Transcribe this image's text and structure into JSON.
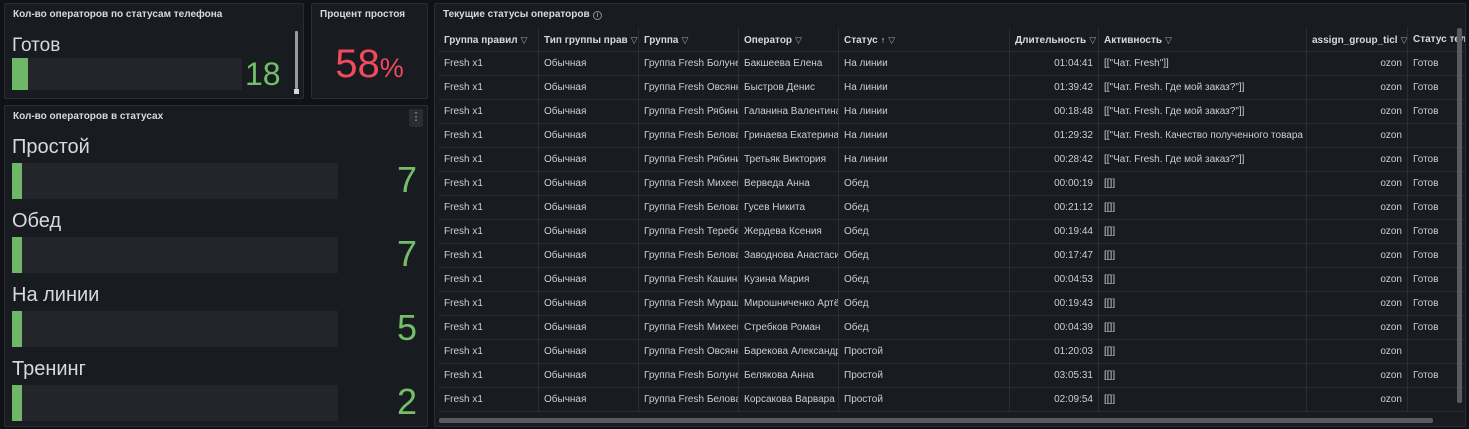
{
  "colors": {
    "green": "#73bf69",
    "red": "#f2495c",
    "panel_bg": "#181b1f",
    "page_bg": "#111217"
  },
  "phone_status_panel": {
    "title": "Кол-во операторов по статусам телефона",
    "items": [
      {
        "label": "Готов",
        "value": "18",
        "fill_fraction": 0.07
      }
    ]
  },
  "idle_panel": {
    "title": "Процент простоя",
    "value": "58",
    "unit": "%"
  },
  "status_count_panel": {
    "title": "Кол-во операторов в статусах",
    "menu_icon": "more-vertical-icon",
    "items": [
      {
        "label": "Простой",
        "value": "7",
        "fill_fraction": 0.03
      },
      {
        "label": "Обед",
        "value": "7",
        "fill_fraction": 0.03
      },
      {
        "label": "На линии",
        "value": "5",
        "fill_fraction": 0.02
      },
      {
        "label": "Тренинг",
        "value": "2",
        "fill_fraction": 0.01
      }
    ]
  },
  "table_panel": {
    "title": "Текущие статусы операторов",
    "info_icon": "info-icon",
    "columns": [
      {
        "label": "Группа правил",
        "filter": true
      },
      {
        "label": "Тип группы прав",
        "filter": true
      },
      {
        "label": "Группа",
        "filter": true
      },
      {
        "label": "Оператор",
        "filter": true
      },
      {
        "label": "Статус",
        "filter": true,
        "sort": "asc"
      },
      {
        "label": "Длительность",
        "filter": true
      },
      {
        "label": "Активность",
        "filter": true
      },
      {
        "label": "assign_group_ticl",
        "filter": true
      },
      {
        "label": "Статус теле",
        "filter": false
      }
    ],
    "rows": [
      [
        "Fresh x1",
        "Обычная",
        "Группа Fresh Болуне",
        "Бакшеева Елена",
        "На линии",
        "01:04:41",
        "[[\"Чат. Fresh\"]]",
        "ozon",
        "Готов"
      ],
      [
        "Fresh x1",
        "Обычная",
        "Группа Fresh Овсянн",
        "Быстров Денис",
        "На линии",
        "01:39:42",
        "[[\"Чат. Fresh. Где мой заказ?\"]]",
        "ozon",
        "Готов"
      ],
      [
        "Fresh x1",
        "Обычная",
        "Группа Fresh Рябини",
        "Галанина Валентина",
        "На линии",
        "00:18:48",
        "[[\"Чат. Fresh. Где мой заказ?\"]]",
        "ozon",
        "Готов"
      ],
      [
        "Fresh x1",
        "Обычная",
        "Группа Fresh Белова",
        "Гринаева Екатерина",
        "На линии",
        "01:29:32",
        "[[\"Чат. Fresh. Качество полученного товара",
        "ozon",
        ""
      ],
      [
        "Fresh x1",
        "Обычная",
        "Группа Fresh Рябини",
        "Третьяк Виктория",
        "На линии",
        "00:28:42",
        "[[\"Чат. Fresh. Где мой заказ?\"]]",
        "ozon",
        "Готов"
      ],
      [
        "Fresh x1",
        "Обычная",
        "Группа Fresh Михеев",
        "Верведа Анна",
        "Обед",
        "00:00:19",
        "[[]]",
        "ozon",
        "Готов"
      ],
      [
        "Fresh x1",
        "Обычная",
        "Группа Fresh Белова",
        "Гусев Никита",
        "Обед",
        "00:21:12",
        "[[]]",
        "ozon",
        "Готов"
      ],
      [
        "Fresh x1",
        "Обычная",
        "Группа Fresh Теребе",
        "Жердева Ксения",
        "Обед",
        "00:19:44",
        "[[]]",
        "ozon",
        "Готов"
      ],
      [
        "Fresh x1",
        "Обычная",
        "Группа Fresh Белова",
        "Заводнова Анастаси",
        "Обед",
        "00:17:47",
        "[[]]",
        "ozon",
        "Готов"
      ],
      [
        "Fresh x1",
        "Обычная",
        "Группа Fresh Кашина",
        "Кузина Мария",
        "Обед",
        "00:04:53",
        "[[]]",
        "ozon",
        "Готов"
      ],
      [
        "Fresh x1",
        "Обычная",
        "Группа Fresh Мураш",
        "Мирошниченко Артё",
        "Обед",
        "00:19:43",
        "[[]]",
        "ozon",
        "Готов"
      ],
      [
        "Fresh x1",
        "Обычная",
        "Группа Fresh Михеев",
        "Стребков Роман",
        "Обед",
        "00:04:39",
        "[[]]",
        "ozon",
        "Готов"
      ],
      [
        "Fresh x1",
        "Обычная",
        "Группа Fresh Овсянн",
        "Барекова Александр",
        "Простой",
        "01:20:03",
        "[[]]",
        "ozon",
        ""
      ],
      [
        "Fresh x1",
        "Обычная",
        "Группа Fresh Болуне",
        "Белякова Анна",
        "Простой",
        "03:05:31",
        "[[]]",
        "ozon",
        "Готов"
      ],
      [
        "Fresh x1",
        "Обычная",
        "Группа Fresh Белова",
        "Корсакова Варвара",
        "Простой",
        "02:09:54",
        "[[]]",
        "ozon",
        ""
      ]
    ]
  }
}
